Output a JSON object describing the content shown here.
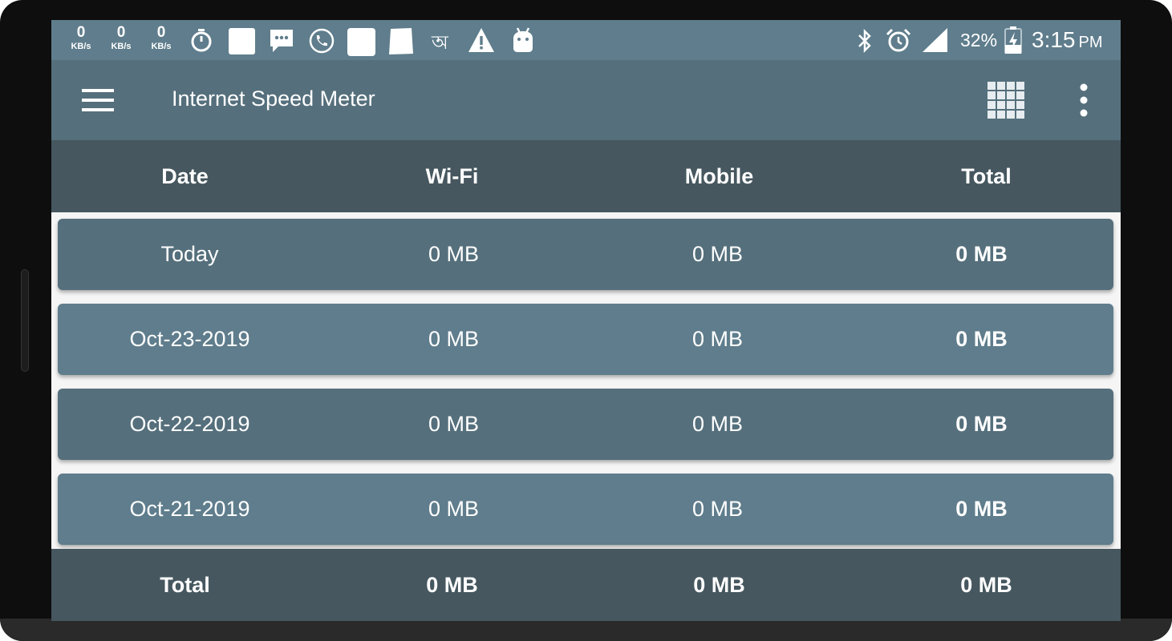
{
  "status_bar": {
    "speeds": [
      {
        "value": "0",
        "unit": "KB/s"
      },
      {
        "value": "0",
        "unit": "KB/s"
      },
      {
        "value": "0",
        "unit": "KB/s"
      }
    ],
    "bengali_glyph": "অ",
    "battery": "32%",
    "time": "3:15",
    "ampm": "PM"
  },
  "app_bar": {
    "title": "Internet Speed Meter"
  },
  "table": {
    "headers": [
      "Date",
      "Wi-Fi",
      "Mobile",
      "Total"
    ],
    "rows": [
      {
        "date": "Today",
        "wifi": "0 MB",
        "mobile": "0 MB",
        "total": "0 MB"
      },
      {
        "date": "Oct-23-2019",
        "wifi": "0 MB",
        "mobile": "0 MB",
        "total": "0 MB"
      },
      {
        "date": "Oct-22-2019",
        "wifi": "0 MB",
        "mobile": "0 MB",
        "total": "0 MB"
      },
      {
        "date": "Oct-21-2019",
        "wifi": "0 MB",
        "mobile": "0 MB",
        "total": "0 MB"
      }
    ],
    "footer": {
      "label": "Total",
      "wifi": "0 MB",
      "mobile": "0 MB",
      "total": "0 MB"
    }
  },
  "colors": {
    "status_bar": "#5f7d8c",
    "app_bar": "#556f7c",
    "header": "#46575f",
    "row_dark": "#556f7c",
    "row_light": "#5f7d8c"
  }
}
